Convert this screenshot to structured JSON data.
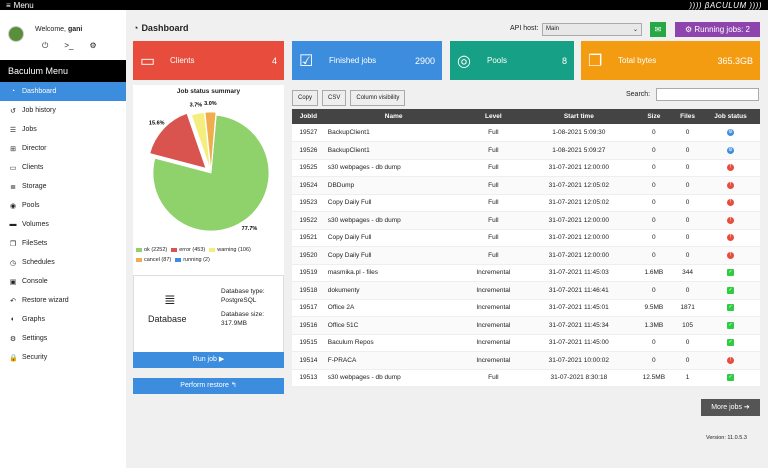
{
  "topbar": {
    "menu_label": "Menu",
    "brand": ")))) βACULUM ))))"
  },
  "user": {
    "welcome": "Welcome,",
    "name": "gani"
  },
  "sidebar": {
    "title": "Baculum Menu",
    "items": [
      {
        "label": "Dashboard",
        "icon": "dashboard-icon",
        "glyph": "◔"
      },
      {
        "label": "Job history",
        "icon": "history-icon",
        "glyph": "↺"
      },
      {
        "label": "Jobs",
        "icon": "list-icon",
        "glyph": "☰"
      },
      {
        "label": "Director",
        "icon": "sitemap-icon",
        "glyph": "⊞"
      },
      {
        "label": "Clients",
        "icon": "desktop-icon",
        "glyph": "▭"
      },
      {
        "label": "Storage",
        "icon": "database-icon",
        "glyph": "≣"
      },
      {
        "label": "Pools",
        "icon": "pool-icon",
        "glyph": "◉"
      },
      {
        "label": "Volumes",
        "icon": "hdd-icon",
        "glyph": "▬"
      },
      {
        "label": "FileSets",
        "icon": "copy-icon",
        "glyph": "❐"
      },
      {
        "label": "Schedules",
        "icon": "clock-icon",
        "glyph": "◷"
      },
      {
        "label": "Console",
        "icon": "terminal-icon",
        "glyph": "▣"
      },
      {
        "label": "Restore wizard",
        "icon": "reply-icon",
        "glyph": "↶"
      },
      {
        "label": "Graphs",
        "icon": "chart-icon",
        "glyph": "◐"
      },
      {
        "label": "Settings",
        "icon": "wrench-icon",
        "glyph": "⚙"
      },
      {
        "label": "Security",
        "icon": "lock-icon",
        "glyph": "🔒"
      }
    ]
  },
  "header": {
    "title": "Dashboard",
    "api_label": "API host:",
    "api_value": "Main",
    "running_jobs": "Running jobs: 2"
  },
  "cards": [
    {
      "label": "Clients",
      "value": "4",
      "color": "#e74c3c",
      "icon": "desktop-icon",
      "glyph": "▭"
    },
    {
      "label": "Finished jobs",
      "value": "2900",
      "color": "#3c8dde",
      "icon": "tasks-icon",
      "glyph": "☑"
    },
    {
      "label": "Pools",
      "value": "8",
      "color": "#16a085",
      "icon": "tape-icon",
      "glyph": "◎"
    },
    {
      "label": "Total bytes",
      "value": "365.3GB",
      "color": "#f39c12",
      "icon": "files-icon",
      "glyph": "❐"
    }
  ],
  "pie": {
    "title": "Job status summary"
  },
  "chart_data": {
    "type": "pie",
    "title": "Job status summary",
    "categories": [
      "ok",
      "error",
      "warning",
      "cancel",
      "running"
    ],
    "values": [
      2252,
      453,
      106,
      87,
      2
    ],
    "percent_labels": [
      "77.7%",
      "15.6%",
      "3.7%",
      "3.0%",
      ""
    ],
    "legend": [
      "ok (2252)",
      "error (453)",
      "warning (106)",
      "cancel (87)",
      "running (2)"
    ],
    "colors": [
      "#8fd16a",
      "#d9534f",
      "#f4ee7e",
      "#f0ad4e",
      "#3c8dde"
    ]
  },
  "db": {
    "label": "Database",
    "type_label": "Database type:",
    "type_value": "PostgreSQL",
    "size_label": "Database size:",
    "size_value": "317.9MB"
  },
  "actions": {
    "run_job": "Run job ▶",
    "perform_restore": "Perform restore ↰"
  },
  "table_tools": {
    "copy": "Copy",
    "csv": "CSV",
    "colvis": "Column visibility",
    "search_label": "Search:"
  },
  "table": {
    "headers": [
      "JobId",
      "Name",
      "Level",
      "Start time",
      "Size",
      "Files",
      "Job status"
    ],
    "rows": [
      {
        "id": "19527",
        "name": "BackupClient1",
        "level": "Full",
        "start": "1-08-2021 5:09:30",
        "size": "0",
        "files": "0",
        "status": "running"
      },
      {
        "id": "19526",
        "name": "BackupClient1",
        "level": "Full",
        "start": "1-08-2021 5:09:27",
        "size": "0",
        "files": "0",
        "status": "running"
      },
      {
        "id": "19525",
        "name": "s30 webpages - db dump",
        "level": "Full",
        "start": "31-07-2021 12:00:00",
        "size": "0",
        "files": "0",
        "status": "error"
      },
      {
        "id": "19524",
        "name": "DBDump",
        "level": "Full",
        "start": "31-07-2021 12:05:02",
        "size": "0",
        "files": "0",
        "status": "error"
      },
      {
        "id": "19523",
        "name": "Copy Daily Full",
        "level": "Full",
        "start": "31-07-2021 12:05:02",
        "size": "0",
        "files": "0",
        "status": "error"
      },
      {
        "id": "19522",
        "name": "s30 webpages - db dump",
        "level": "Full",
        "start": "31-07-2021 12:00:00",
        "size": "0",
        "files": "0",
        "status": "error"
      },
      {
        "id": "19521",
        "name": "Copy Daily Full",
        "level": "Full",
        "start": "31-07-2021 12:00:00",
        "size": "0",
        "files": "0",
        "status": "error"
      },
      {
        "id": "19520",
        "name": "Copy Daily Full",
        "level": "Full",
        "start": "31-07-2021 12:00:00",
        "size": "0",
        "files": "0",
        "status": "error"
      },
      {
        "id": "19519",
        "name": "masmika.pl - files",
        "level": "Incremental",
        "start": "31-07-2021 11:45:03",
        "size": "1.6MB",
        "files": "344",
        "status": "ok"
      },
      {
        "id": "19518",
        "name": "dokumenty",
        "level": "Incremental",
        "start": "31-07-2021 11:46:41",
        "size": "0",
        "files": "0",
        "status": "ok"
      },
      {
        "id": "19517",
        "name": "Office 2A",
        "level": "Incremental",
        "start": "31-07-2021 11:45:01",
        "size": "9.5MB",
        "files": "1871",
        "status": "ok"
      },
      {
        "id": "19516",
        "name": "Office 51C",
        "level": "Incremental",
        "start": "31-07-2021 11:45:34",
        "size": "1.3MB",
        "files": "105",
        "status": "ok"
      },
      {
        "id": "19515",
        "name": "Baculum Repos",
        "level": "Incremental",
        "start": "31-07-2021 11:45:00",
        "size": "0",
        "files": "0",
        "status": "ok"
      },
      {
        "id": "19514",
        "name": "F-PRACA",
        "level": "Incremental",
        "start": "31-07-2021 10:00:02",
        "size": "0",
        "files": "0",
        "status": "error"
      },
      {
        "id": "19513",
        "name": "s30 webpages - db dump",
        "level": "Full",
        "start": "31-07-2021 8:30:18",
        "size": "12.5MB",
        "files": "1",
        "status": "ok"
      }
    ]
  },
  "more_jobs": "More jobs ➔",
  "version": "Version: 11.0.5.3"
}
